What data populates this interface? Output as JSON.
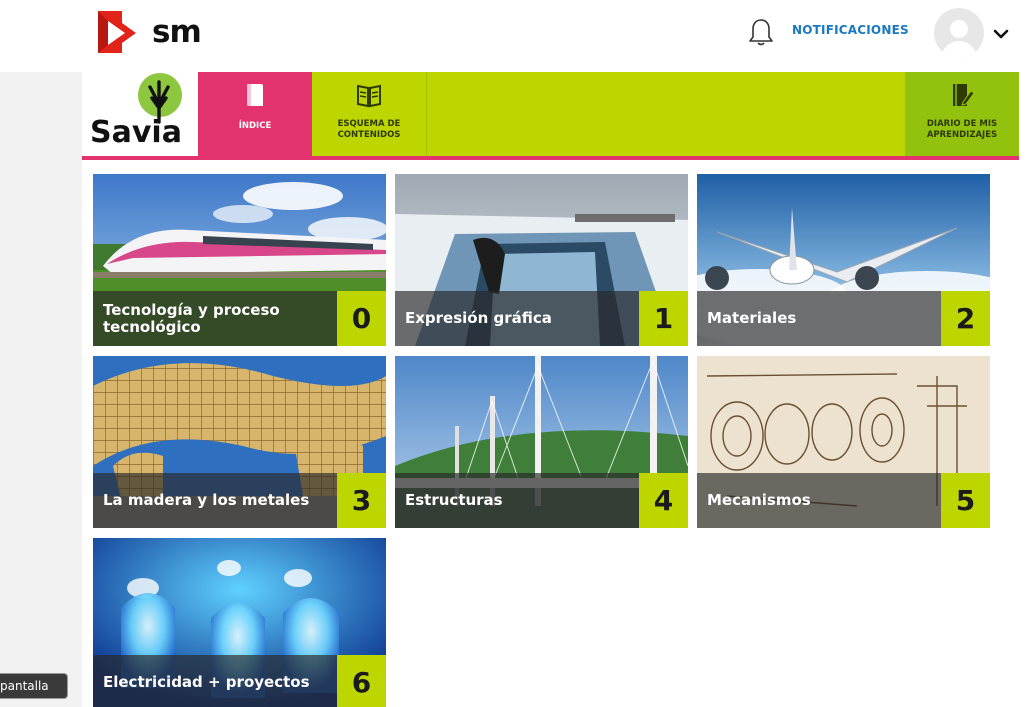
{
  "header": {
    "brand_name": "sm",
    "notifications_label": "NOTIFICACIONES"
  },
  "brand": {
    "product_name": "Savia"
  },
  "nav": {
    "tabs": [
      {
        "label": "ÍNDICE",
        "icon": "book-icon",
        "active": true
      },
      {
        "label": "ESQUEMA DE\nCONTENIDOS",
        "icon": "open-book-icon",
        "active": false
      },
      {
        "label": "DIARIO DE MIS\nAPRENDIZAJES",
        "icon": "journal-pen-icon",
        "active": false
      }
    ]
  },
  "units": [
    {
      "title": "Tecnología y proceso tecnológico",
      "number": "0",
      "image": "bullet-train-photo"
    },
    {
      "title": "Expresión gráfica",
      "number": "1",
      "image": "street-art-3d-photo"
    },
    {
      "title": "Materiales",
      "number": "2",
      "image": "airplane-photo"
    },
    {
      "title": "La madera y los metales",
      "number": "3",
      "image": "wooden-structure-photo"
    },
    {
      "title": "Estructuras",
      "number": "4",
      "image": "cable-bridge-photo"
    },
    {
      "title": "Mecanismos",
      "number": "5",
      "image": "mechanism-sketch-photo"
    },
    {
      "title": "Electricidad + proyectos",
      "number": "6",
      "image": "blue-leds-photo"
    }
  ],
  "footer": {
    "pantalla_label": "pantalla"
  },
  "colors": {
    "brand_red": "#e2231a",
    "nav_green": "#bed600",
    "active_pink": "#e2336e",
    "diario_green": "#93c20e",
    "notifications_blue": "#1a78c2"
  }
}
